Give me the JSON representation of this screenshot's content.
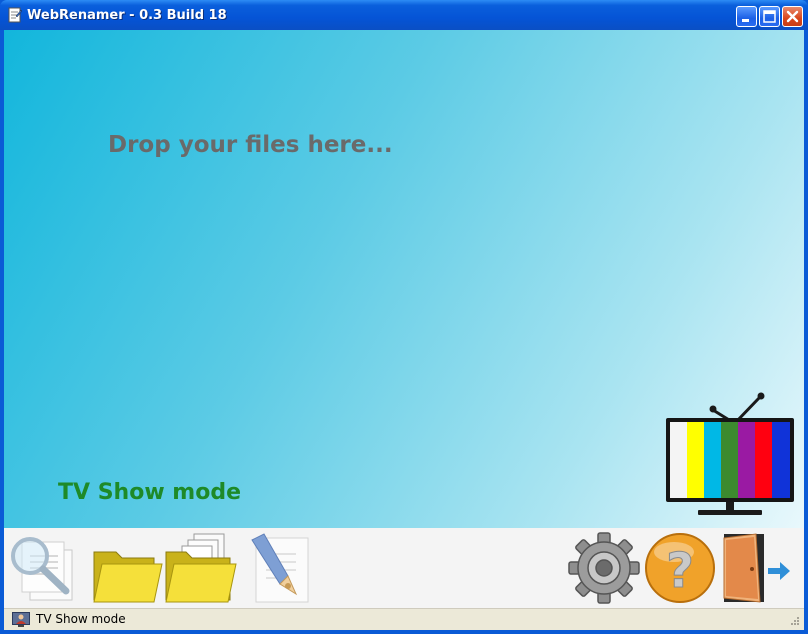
{
  "window": {
    "title": "WebRenamer - 0.3 Build 18"
  },
  "drop_area": {
    "prompt": "Drop your files here...",
    "mode_label": "TV Show mode",
    "mode_icon": "tv-icon"
  },
  "toolbar": {
    "left_buttons": [
      "search-files-icon",
      "open-folder-icon",
      "open-folder-files-icon",
      "rename-pen-icon"
    ],
    "right_buttons": [
      "settings-gear-icon",
      "help-question-icon",
      "exit-door-icon"
    ]
  },
  "statusbar": {
    "text": "TV Show mode",
    "icon": "tv-presenter-icon"
  },
  "colors": {
    "mode_text": "#1e8a28",
    "prompt_text": "#6a6a6a",
    "titlebar": "#0554d6"
  }
}
